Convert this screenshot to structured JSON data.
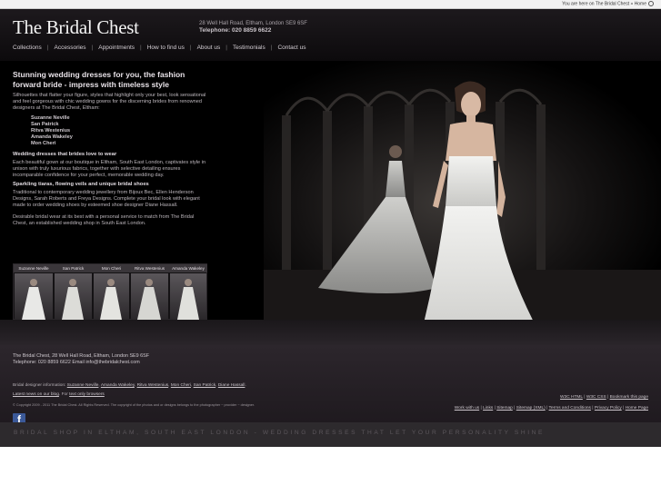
{
  "top_bar": {
    "breadcrumb": "You are here on The Bridal Chest » Home"
  },
  "header": {
    "logo": "The Bridal Chest",
    "address": "28 Well Hall Road, Eltham, London SE9 6SF",
    "phone": "Telephone: 020 8859 6622"
  },
  "nav": {
    "items": [
      {
        "label": "Collections"
      },
      {
        "label": "Accessories"
      },
      {
        "label": "Appointments"
      },
      {
        "label": "How to find us"
      },
      {
        "label": "About us"
      },
      {
        "label": "Testimonials"
      },
      {
        "label": "Contact us"
      }
    ]
  },
  "content": {
    "heading": "Stunning wedding dresses for you, the fashion forward bride - impress with timeless style",
    "intro": "Silhouettes that flatter your figure, styles that highlight only your best, look sensational and feel gorgeous with chic wedding gowns for the discerning brides from renowned designers at The Bridal Chest, Eltham:",
    "designers": [
      "Suzanne Neville",
      "San Patrick",
      "Ritva Westenius",
      "Amanda Wakeley",
      "Mon Cheri"
    ],
    "section2_title": "Wedding dresses that brides love to wear",
    "section2_text": "Each beautiful gown at our boutique in Eltham, South East London, captivates style in unison with truly luxurious fabrics, together with selective detailing ensures incomparable confidence for your perfect, memorable wedding day.",
    "section3_title": "Sparkling tiaras, flowing veils and unique bridal shoes",
    "section3_text": "Traditional to contemporary wedding jewellery from Bijoux Bec, Ellen Henderson Designs, Sarah Roberts and Freya Designs. Complete your bridal look with elegant made to order wedding shoes by esteemed shoe designer Diane Hassall.",
    "section4_text": "Desirable bridal wear at its best with a personal service to match from The Bridal Chest, an established wedding shop in South East London."
  },
  "thumbnails": [
    {
      "label": "Suzanne Neville"
    },
    {
      "label": "San Patrick"
    },
    {
      "label": "Mon Cheri"
    },
    {
      "label": "Ritva Westenius"
    },
    {
      "label": "Amanda Wakeley"
    }
  ],
  "footer": {
    "address_line1": "The Bridal Chest, 28 Well Hall Road, Eltham, London SE9 6SF",
    "address_line2": "Telephone: 020 8859 6622 Email info@thebridalchest.com",
    "designers_label": "Bridal designer information:",
    "designer_links": [
      "Suzanne Neville",
      "Amanda Wakeley",
      "Ritva Westenius",
      "Mon Cheri",
      "San Patrick",
      "Diane Hassall"
    ],
    "news_link": "Latest news on our blog",
    "news_mid": ". For",
    "text_only_link": "text only browsers",
    "copyright": "© Copyright 2009 - 2011 The Bridal Chest. All Rights Reserved. The copyright of the photos and or designs belongs to the photographer ~ provider ~ designer.",
    "valid_links": [
      "W3C HTML",
      "W3C CSS",
      "Bookmark this page"
    ],
    "ext_links": [
      "Work with us",
      "Links",
      "Sitemap",
      "Sitemap (XML)",
      "Terms and Conditions",
      "Privacy Policy",
      "Home Page"
    ],
    "social_icon": "f",
    "tagline": "BRIDAL SHOP IN ELTHAM, SOUTH EAST LONDON - WEDDING DRESSES THAT LET YOUR PERSONALITY SHINE"
  },
  "colors": {
    "background": "#000000",
    "footer": "#2c262c",
    "facebook": "#3b5998"
  }
}
